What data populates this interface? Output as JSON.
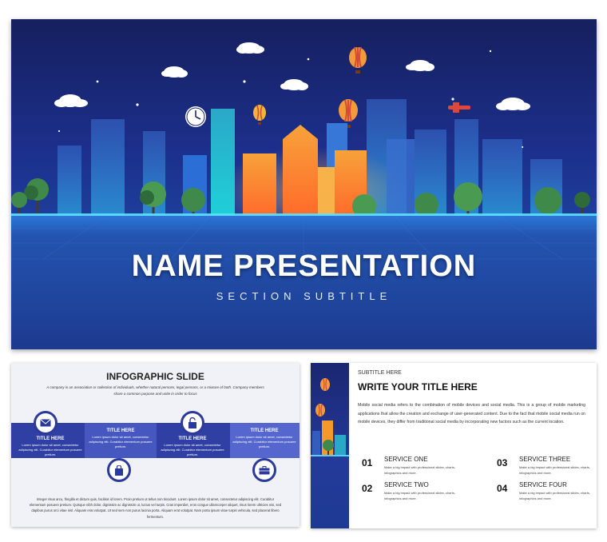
{
  "main_slide": {
    "title": "NAME PRESENTATION",
    "subtitle": "SECTION SUBTITLE"
  },
  "infographic_slide": {
    "title": "INFOGRAPHIC SLIDE",
    "intro": "A company is an association or collection of individuals, whether natural persons, legal persons, or a mixture of both. Company members share a common purpose and unite in order to focus",
    "items": [
      {
        "title": "TITLE HERE",
        "text": "Lorem ipsum dolor sit amet, consectetur adipiscing elit. Curabitur elementum posuere pretium.",
        "icon": "envelope-icon"
      },
      {
        "title": "TITLE HERE",
        "text": "Lorem ipsum dolor sit amet, consectetur adipiscing elit. Curabitur elementum posuere pretium.",
        "icon": "shopping-bag-icon"
      },
      {
        "title": "TITLE HERE",
        "text": "Lorem ipsum dolor sit amet, consectetur adipiscing elit. Curabitur elementum posuere pretium.",
        "icon": "lock-icon"
      },
      {
        "title": "TITLE HERE",
        "text": "Lorem ipsum dolor sit amet, consectetur adipiscing elit. Curabitur elementum posuere pretium.",
        "icon": "briefcase-icon"
      }
    ],
    "footer": "Integer risus arcu, fringilla et dictum quis, facilisis id lorem. Proin pretium ut tellus non tincidunt. Lorem ipsum dolor sit amet, consectetur adipiscing elit. Curabitur elementum posuere pretium. Quisque nibh dolor, dignissim ac dignissim ut, luctus vel turpis. Cras imperdiet, eros congue ullamcorper aliquet, risus lorem ultricies nisi, sed dapibus purus orci vitae nisl. Aliquam erat volutpat. Ut sed sem non purus lacinia porta. Aliquam erat volutpat. Nam porta ipsum vitae turpis vehicula, sed placerat libero fermentum."
  },
  "content_slide": {
    "subtitle": "SUBTITLE HERE",
    "title": "WRITE YOUR TITLE HERE",
    "body": "Mobile social media refers to the combination of mobile devices and social media. This is a group of mobile marketing applications that allow the creation and exchange of user-generated content. Due to the fact that mobile social media run on mobile devices, they differ from traditional social media by incorporating new factors such as the current location.",
    "services": [
      {
        "number": "01",
        "title": "SERVICE ONE",
        "text": "Make a big impact with professional slides, charts, infographics and more."
      },
      {
        "number": "02",
        "title": "SERVICE TWO",
        "text": "Make a big impact with professional slides, charts, infographics and more."
      },
      {
        "number": "03",
        "title": "SERVICE THREE",
        "text": "Make a big impact with professional slides, charts, infographics and more."
      },
      {
        "number": "04",
        "title": "SERVICE FOUR",
        "text": "Make a big impact with professional slides, charts, infographics and more."
      }
    ]
  },
  "colors": {
    "sky_dark": "#16205e",
    "sky_blue": "#1e3f9c",
    "infographic_band": "#3b4bb5",
    "building_orange": "#f59a2a",
    "glow_cyan": "#5ee0ff"
  }
}
